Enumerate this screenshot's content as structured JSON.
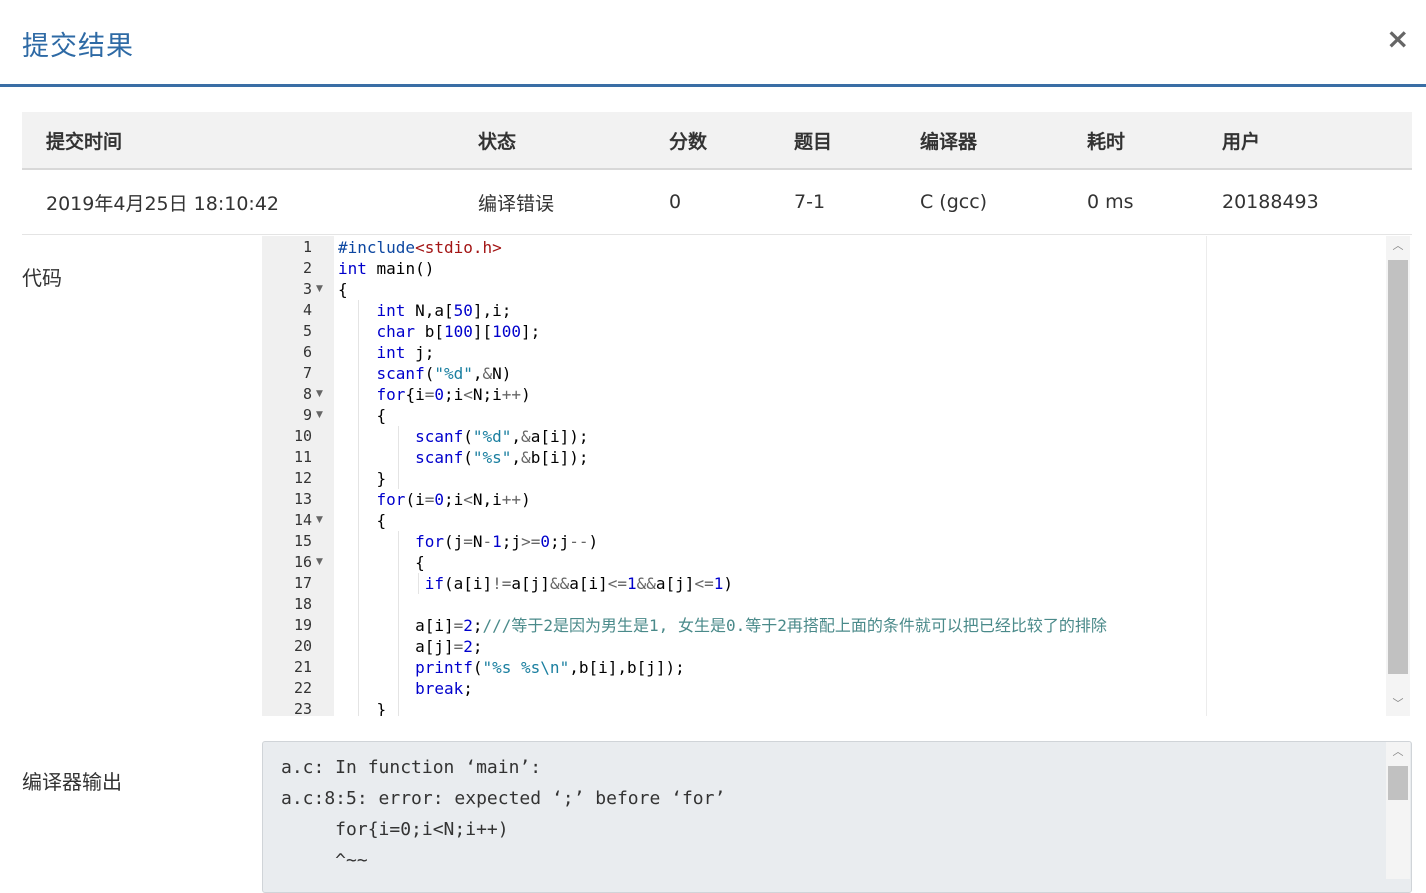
{
  "dialog": {
    "title": "提交结果",
    "close_icon": "×"
  },
  "table": {
    "headers": [
      "提交时间",
      "状态",
      "分数",
      "题目",
      "编译器",
      "耗时",
      "用户"
    ],
    "row": {
      "time": "2019年4月25日 18:10:42",
      "status": "编译错误",
      "score": "0",
      "problem": "7-1",
      "compiler": "C (gcc)",
      "duration": "0 ms",
      "user": "20188493"
    }
  },
  "labels": {
    "code": "代码",
    "compiler_output": "编译器输出"
  },
  "code": {
    "line_numbers": [
      "1",
      "2",
      "3",
      "4",
      "5",
      "6",
      "7",
      "8",
      "9",
      "10",
      "11",
      "12",
      "13",
      "14",
      "15",
      "16",
      "17",
      "18",
      "19",
      "20",
      "21",
      "22",
      "23"
    ],
    "lines": [
      "#include<stdio.h>",
      "int main()",
      "{",
      "    int N,a[50],i;",
      "    char b[100][100];",
      "    int j;",
      "    scanf(\"%d\",&N)",
      "    for{i=0;i<N;i++)",
      "    {",
      "        scanf(\"%d\",&a[i]);",
      "        scanf(\"%s\",&b[i]);",
      "    }",
      "    for(i=0;i<N,i++)",
      "    {",
      "        for(j=N-1;j>=0;j--)",
      "        {",
      "         if(a[i]!=a[j]&&a[i]<=1&&a[j]<=1)",
      "",
      "        a[i]=2;///等于2是因为男生是1, 女生是0.等于2再搭配上面的条件就可以把已经比较了的排除",
      "        a[j]=2;",
      "        printf(\"%s %s\\n\",b[i],b[j]);",
      "        break;",
      "    }"
    ],
    "fold_lines": [
      "3",
      "8",
      "9",
      "14",
      "16"
    ]
  },
  "compiler_output": {
    "lines": [
      "a.c: In function ‘main’:",
      "a.c:8:5: error: expected ‘;’ before ‘for’",
      "     for{i=0;i<N;i++)",
      "     ^~~"
    ]
  },
  "colors": {
    "accent": "#3a6ea5",
    "link": "#2e9ed6",
    "keyword": "#0000cc",
    "string": "#1a7fa0"
  }
}
